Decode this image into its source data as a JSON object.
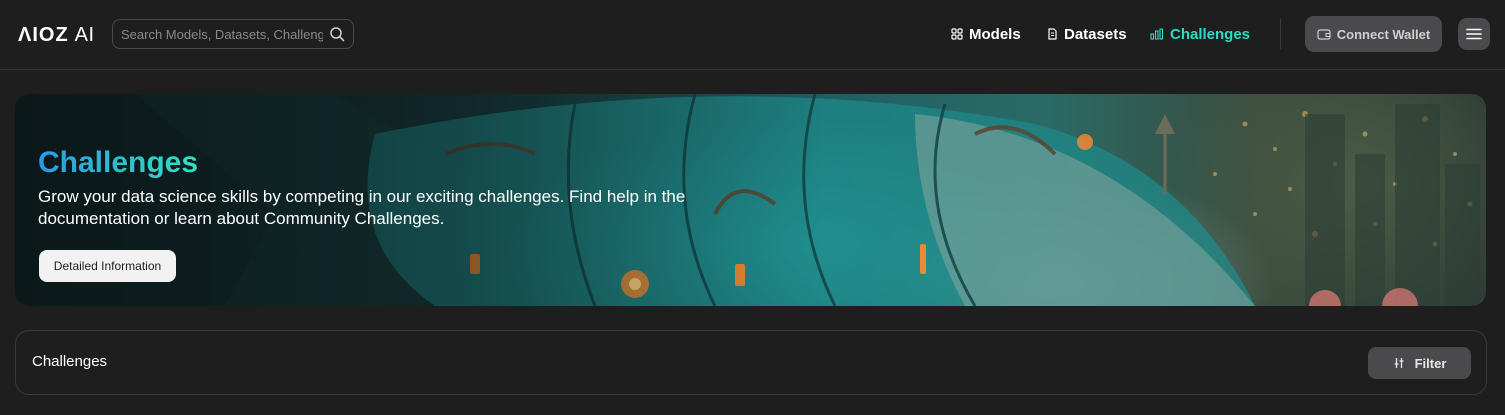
{
  "brand": {
    "logo_mark": "ΛIOZ",
    "logo_suffix": "AI"
  },
  "search": {
    "placeholder": "Search Models, Datasets, Challenges"
  },
  "nav": {
    "models": {
      "label": "Models",
      "icon": "grid-icon"
    },
    "datasets": {
      "label": "Datasets",
      "icon": "file-icon"
    },
    "challenges": {
      "label": "Challenges",
      "icon": "bar-chart-icon",
      "active": true
    }
  },
  "header_actions": {
    "connect_wallet": {
      "label": "Connect Wallet",
      "icon": "wallet-icon"
    },
    "menu": {
      "icon": "hamburger-menu-icon"
    }
  },
  "hero": {
    "title": "Challenges",
    "description": "Grow your data science skills by competing in our exciting challenges. Find help in the documentation or learn about Community Challenges.",
    "button_label": "Detailed Information"
  },
  "panel": {
    "title": "Challenges",
    "filter_label": "Filter",
    "filter_icon": "sliders-icon"
  },
  "colors": {
    "background": "#1e1e1e",
    "accent": "#2fd9c7",
    "button_gray": "#4a4a4d"
  }
}
